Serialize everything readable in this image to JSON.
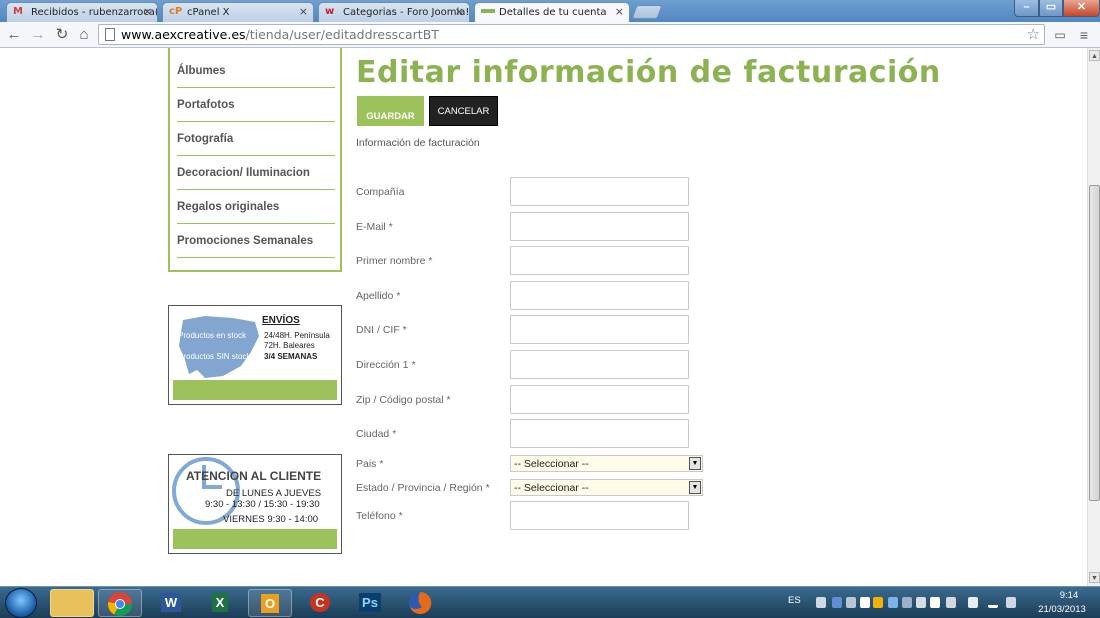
{
  "browser": {
    "tabs": [
      {
        "label": "Recibidos - rubenzarroca(",
        "icon": "gmail-icon",
        "favicon": "M",
        "color": "#c94434"
      },
      {
        "label": "cPanel X",
        "icon": "cpanel-icon",
        "favicon": "cP",
        "color": "#e07b1f"
      },
      {
        "label": "Categorias - Foro Joomla!",
        "icon": "joomla-icon",
        "favicon": "w",
        "color": "#c8232c"
      },
      {
        "label": "Detalles de tu cuenta",
        "icon": "page-icon",
        "favicon": "",
        "color": "#8cb251"
      }
    ],
    "url_domain": "www.aexcreative.es",
    "url_path": "/tienda/user/editaddresscartBT"
  },
  "sidebar": {
    "menu": [
      "Álbumes",
      "Portafotos",
      "Fotografía",
      "Decoracion/ Iluminacion",
      "Regalos originales",
      "Promociones Semanales"
    ],
    "envios": {
      "title": "ENVÍOS",
      "stock_label": "Productos en stock",
      "nostock_label": "Productos SIN stock",
      "line1": "24/48H. Península",
      "line2": "72H. Baleares",
      "line3": "3/4 SEMANAS"
    },
    "atencion": {
      "title": "ATENCION AL CLIENTE",
      "line1": "DE LUNES A JUEVES",
      "line2": "9:30 - 13:30 / 15:30 - 19:30",
      "line3": "VIERNES  9:30 - 14:00"
    }
  },
  "form": {
    "title": "Editar información de facturación",
    "save_label": "GUARDAR",
    "cancel_label": "CANCELAR",
    "section": "Información de facturación",
    "fields": [
      {
        "label": "Compañía",
        "value": ""
      },
      {
        "label": "E-Mail *",
        "value": ""
      },
      {
        "label": "Primer nombre *",
        "value": ""
      },
      {
        "label": "Apellido *",
        "value": ""
      },
      {
        "label": "DNI / CIF *",
        "value": ""
      },
      {
        "label": "Dirección 1 *",
        "value": ""
      },
      {
        "label": "Zip / Código postal *",
        "value": ""
      },
      {
        "label": "Ciudad *",
        "value": ""
      }
    ],
    "pais_label": "Pais *",
    "pais_value": "-- Seleccionar --",
    "estado_label": "Estado / Provincia / Región *",
    "estado_value": "-- Seleccionar --",
    "telefono_label": "Teléfono *",
    "telefono_value": ""
  },
  "taskbar": {
    "language": "ES",
    "time": "9:14",
    "date": "21/03/2013",
    "apps": [
      {
        "name": "explorer",
        "glyph": "",
        "color": "#e9c15a"
      },
      {
        "name": "chrome",
        "glyph": "",
        "color": "#3c9a3c"
      },
      {
        "name": "word",
        "glyph": "W",
        "color": "#2b579a"
      },
      {
        "name": "excel",
        "glyph": "X",
        "color": "#207245"
      },
      {
        "name": "outlook",
        "glyph": "O",
        "color": "#e8a020"
      },
      {
        "name": "ccleaner",
        "glyph": "C",
        "color": "#c8331f"
      },
      {
        "name": "photoshop",
        "glyph": "Ps",
        "color": "#0b3f6e"
      },
      {
        "name": "firefox",
        "glyph": "",
        "color": "#e66a1c"
      }
    ]
  },
  "colors": {
    "accent_green": "#8cb251",
    "menu_border": "#9dc15b"
  }
}
